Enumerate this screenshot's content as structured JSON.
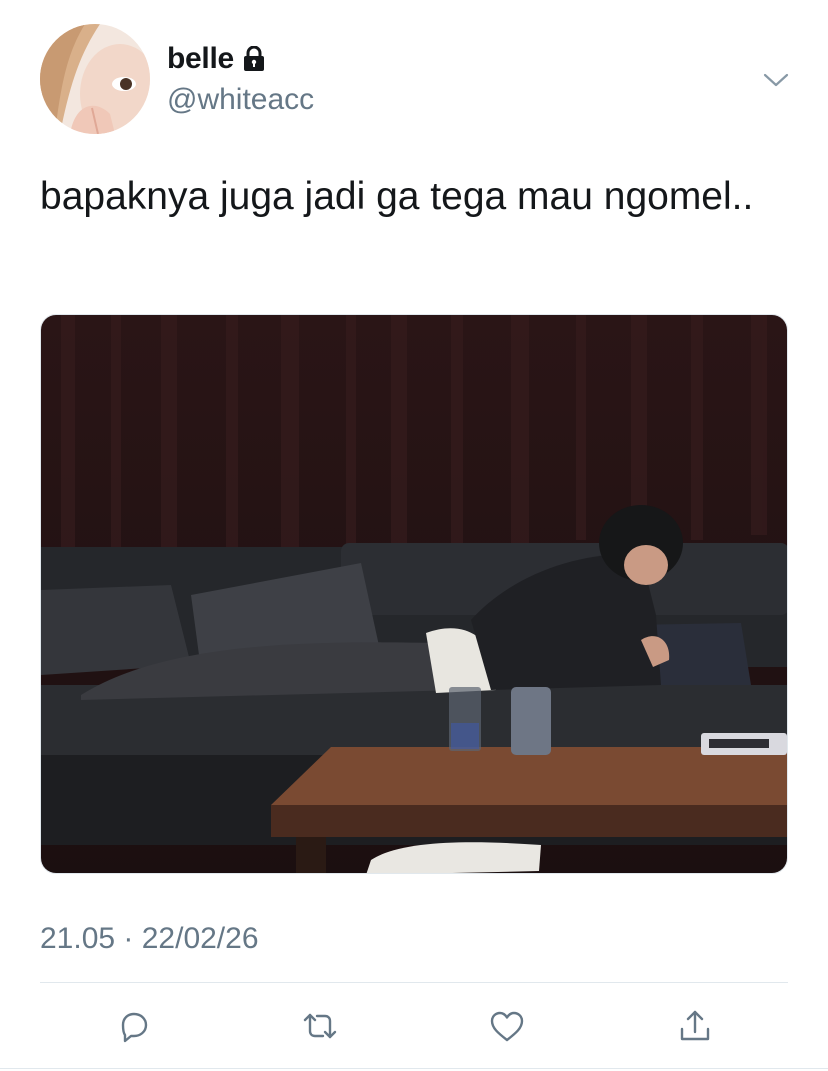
{
  "user": {
    "display_name": "belle",
    "handle": "@whiteacc",
    "protected_icon": "lock-icon"
  },
  "tweet": {
    "text": "bapaknya juga jadi ga tega mau ngomel..",
    "media_alt": "",
    "timestamp": "21.05 · 22/02/26"
  },
  "actions": {
    "reply_icon": "reply-icon",
    "retweet_icon": "retweet-icon",
    "like_icon": "like-icon",
    "share_icon": "share-icon"
  },
  "colors": {
    "text": "#14171a",
    "secondary": "#657786",
    "divider": "#e1e8ed",
    "icon": "#657786"
  }
}
